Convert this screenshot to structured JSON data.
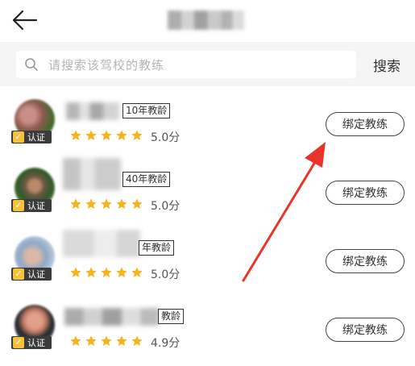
{
  "search": {
    "placeholder": "请搜索该驾校的教练",
    "button_label": "搜索"
  },
  "coaches": [
    {
      "experience": "10年教龄",
      "rating": "5.0分",
      "stars": 5,
      "verified_label": "认证",
      "bind_label": "绑定教练"
    },
    {
      "experience": "40年教龄",
      "rating": "5.0分",
      "stars": 5,
      "verified_label": "认证",
      "bind_label": "绑定教练"
    },
    {
      "experience": "年教龄",
      "rating": "5.0分",
      "stars": 5,
      "verified_label": "认证",
      "bind_label": "绑定教练"
    },
    {
      "experience": "教龄",
      "rating": "4.9分",
      "stars": 5,
      "verified_label": "认证",
      "bind_label": "绑定教练"
    }
  ],
  "colors": {
    "star": "#f5b31d",
    "badge": "#3b3b3b",
    "badge_check": "#f7c23a",
    "arrow": "#e8352b",
    "search_bar_bg": "#f5f5f5"
  },
  "icons": {
    "back": "arrow-left-icon",
    "search": "search-icon",
    "star": "star-icon",
    "verified": "check-badge-icon"
  }
}
